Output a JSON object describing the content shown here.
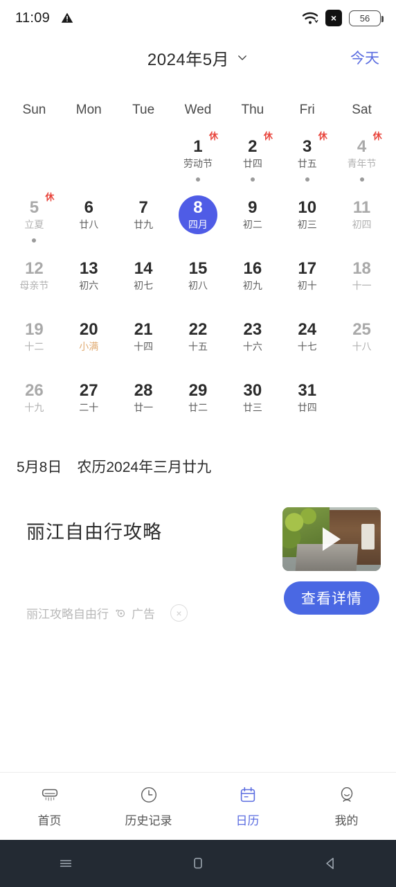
{
  "status_bar": {
    "time": "11:09",
    "warning_icon": "warning-triangle-icon",
    "wifi_icon": "wifi-icon",
    "x_badge": "×",
    "battery_level": "56"
  },
  "header": {
    "title": "2024年5月",
    "dropdown_icon": "chevron-down-icon",
    "today_label": "今天",
    "today_color": "#5a6ce0"
  },
  "calendar": {
    "weekdays": [
      "Sun",
      "Mon",
      "Tue",
      "Wed",
      "Thu",
      "Fri",
      "Sat"
    ],
    "selected_color": "#4f5ce6",
    "rest_badge": "休",
    "weeks": [
      [
        {
          "day": "",
          "lunar": ""
        },
        {
          "day": "",
          "lunar": ""
        },
        {
          "day": "",
          "lunar": ""
        },
        {
          "day": "1",
          "lunar": "劳动节",
          "rest": true,
          "dot": true
        },
        {
          "day": "2",
          "lunar": "廿四",
          "rest": true,
          "dot": true
        },
        {
          "day": "3",
          "lunar": "廿五",
          "rest": true,
          "dot": true
        },
        {
          "day": "4",
          "lunar": "青年节",
          "rest": true,
          "dot": true,
          "dim": true
        }
      ],
      [
        {
          "day": "5",
          "lunar": "立夏",
          "rest": true,
          "dot": true,
          "dim": true,
          "lunar_style": "term"
        },
        {
          "day": "6",
          "lunar": "廿八"
        },
        {
          "day": "7",
          "lunar": "廿九"
        },
        {
          "day": "8",
          "lunar": "四月",
          "selected": true
        },
        {
          "day": "9",
          "lunar": "初二"
        },
        {
          "day": "10",
          "lunar": "初三"
        },
        {
          "day": "11",
          "lunar": "初四",
          "dim": true
        }
      ],
      [
        {
          "day": "12",
          "lunar": "母亲节",
          "dim": true,
          "lunar_style": "fest"
        },
        {
          "day": "13",
          "lunar": "初六"
        },
        {
          "day": "14",
          "lunar": "初七"
        },
        {
          "day": "15",
          "lunar": "初八"
        },
        {
          "day": "16",
          "lunar": "初九"
        },
        {
          "day": "17",
          "lunar": "初十"
        },
        {
          "day": "18",
          "lunar": "十一",
          "dim": true
        }
      ],
      [
        {
          "day": "19",
          "lunar": "十二",
          "dim": true
        },
        {
          "day": "20",
          "lunar": "小满",
          "lunar_style": "term"
        },
        {
          "day": "21",
          "lunar": "十四"
        },
        {
          "day": "22",
          "lunar": "十五"
        },
        {
          "day": "23",
          "lunar": "十六"
        },
        {
          "day": "24",
          "lunar": "十七"
        },
        {
          "day": "25",
          "lunar": "十八",
          "dim": true
        }
      ],
      [
        {
          "day": "26",
          "lunar": "十九",
          "dim": true
        },
        {
          "day": "27",
          "lunar": "二十"
        },
        {
          "day": "28",
          "lunar": "廿一"
        },
        {
          "day": "29",
          "lunar": "廿二"
        },
        {
          "day": "30",
          "lunar": "廿三"
        },
        {
          "day": "31",
          "lunar": "廿四"
        },
        {
          "day": "",
          "lunar": ""
        }
      ]
    ]
  },
  "date_info": {
    "solar": "5月8日",
    "lunar": "农历2024年三月廿九"
  },
  "ad": {
    "title": "丽江自由行攻略",
    "source": "丽江攻略自由行",
    "ad_mark_icon": "ad-mark-icon",
    "ad_label": "广告",
    "close_icon": "×",
    "thumbnail_icon": "play-button-icon",
    "cta_label": "查看详情",
    "cta_color": "#4a68e3"
  },
  "bottom_nav": {
    "items": [
      {
        "label": "首页",
        "icon": "air-conditioner-icon",
        "active": false
      },
      {
        "label": "历史记录",
        "icon": "clock-icon",
        "active": false
      },
      {
        "label": "日历",
        "icon": "calendar-icon",
        "active": true
      },
      {
        "label": "我的",
        "icon": "person-icon",
        "active": false
      }
    ],
    "active_color": "#5a6ce0"
  },
  "system_bar": {
    "recents_icon": "menu-icon",
    "home_icon": "home-square-icon",
    "back_icon": "back-triangle-icon",
    "background": "#232a33"
  }
}
